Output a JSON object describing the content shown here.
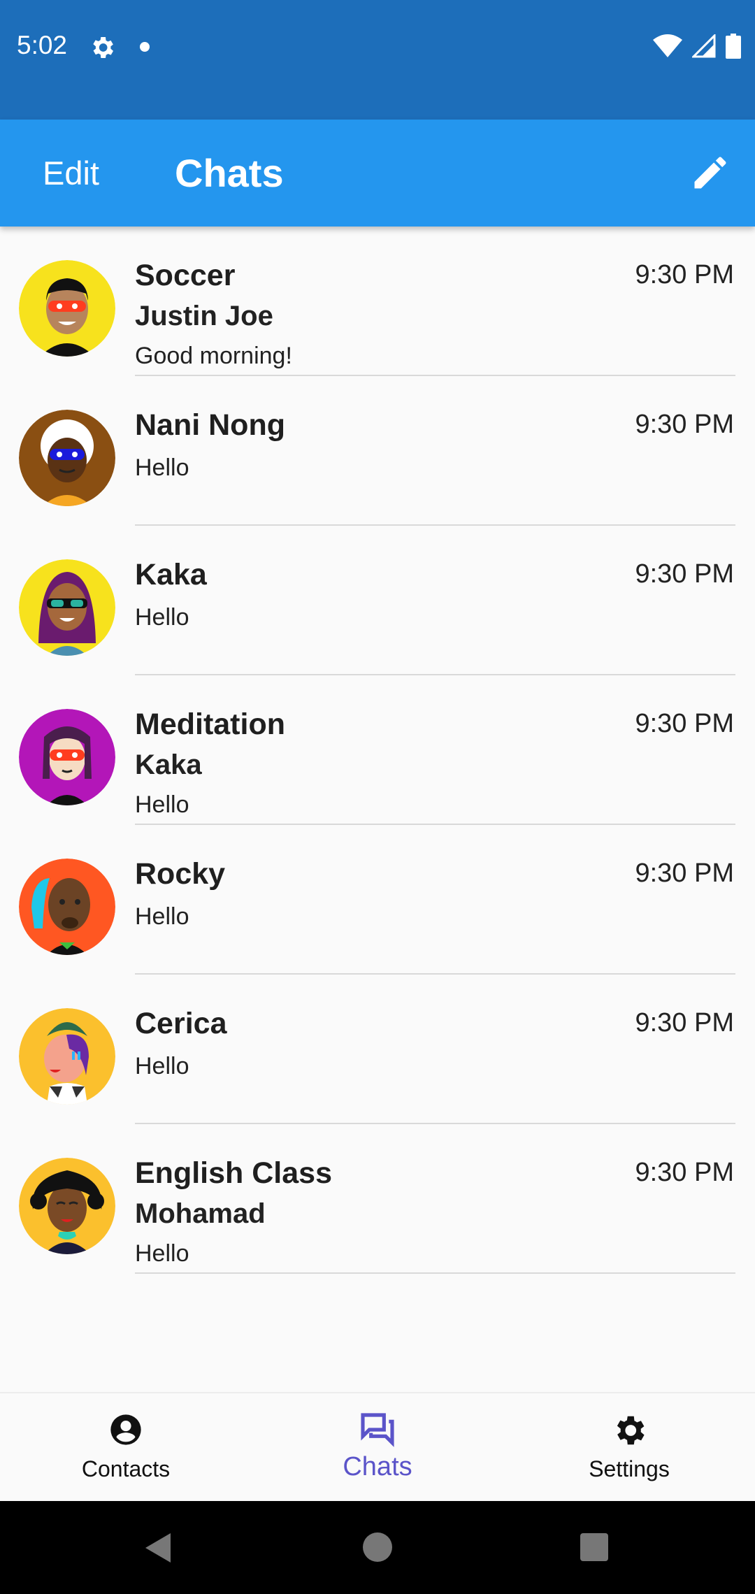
{
  "status_bar": {
    "time": "5:02"
  },
  "app_bar": {
    "edit_label": "Edit",
    "title": "Chats",
    "compose_icon": "pencil-icon"
  },
  "chats": [
    {
      "name": "Soccer",
      "time": "9:30 PM",
      "sender": "Justin Joe",
      "message": "Good morning!",
      "avatar_color": "#f7e21d"
    },
    {
      "name": "Nani Nong",
      "time": "9:30 PM",
      "sender": "",
      "message": "Hello",
      "avatar_color": "#8a4f12"
    },
    {
      "name": "Kaka",
      "time": "9:30 PM",
      "sender": "",
      "message": "Hello",
      "avatar_color": "#f7e21d"
    },
    {
      "name": "Meditation",
      "time": "9:30 PM",
      "sender": "Kaka",
      "message": "Hello",
      "avatar_color": "#b316b8"
    },
    {
      "name": "Rocky",
      "time": "9:30 PM",
      "sender": "",
      "message": "Hello",
      "avatar_color": "#ff5722"
    },
    {
      "name": "Cerica",
      "time": "9:30 PM",
      "sender": "",
      "message": "Hello",
      "avatar_color": "#fbc02d"
    },
    {
      "name": "English Class",
      "time": "9:30 PM",
      "sender": "Mohamad",
      "message": "Hello",
      "avatar_color": "#fbc02d"
    }
  ],
  "bottom_nav": {
    "contacts_label": "Contacts",
    "chats_label": "Chats",
    "settings_label": "Settings",
    "active_color": "#5b54c9"
  }
}
